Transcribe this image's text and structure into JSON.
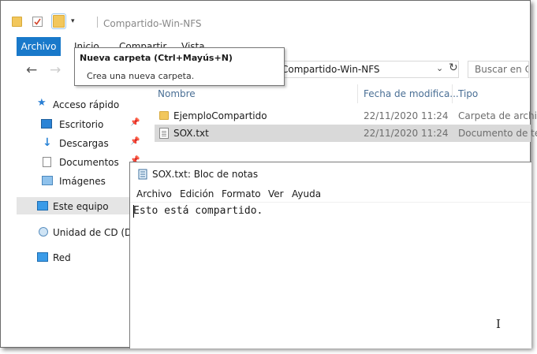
{
  "window": {
    "title": "Compartido-Win-NFS"
  },
  "ribbon": {
    "tabs": [
      {
        "label": "Archivo"
      },
      {
        "label": "Inicio"
      },
      {
        "label": "Compartir"
      },
      {
        "label": "Vista"
      }
    ]
  },
  "tooltip": {
    "title": "Nueva carpeta (Ctrl+Mayús+N)",
    "description": "Crea una nueva carpeta."
  },
  "address": {
    "path": "Compartido-Win-NFS"
  },
  "search": {
    "placeholder": "Buscar en Co"
  },
  "sidebar": {
    "items": [
      {
        "label": "Acceso rápido",
        "icon": "star-icon"
      },
      {
        "label": "Escritorio",
        "icon": "desktop-icon"
      },
      {
        "label": "Descargas",
        "icon": "download-icon"
      },
      {
        "label": "Documentos",
        "icon": "documents-icon"
      },
      {
        "label": "Imágenes",
        "icon": "images-icon"
      },
      {
        "label": "Este equipo",
        "icon": "computer-icon"
      },
      {
        "label": "Unidad de CD (D:)",
        "icon": "cd-drive-icon"
      },
      {
        "label": "Red",
        "icon": "network-icon"
      }
    ]
  },
  "columns": {
    "name": "Nombre",
    "date": "Fecha de modifica...",
    "type": "Tipo"
  },
  "files": [
    {
      "name": "EjemploCompartido",
      "date": "22/11/2020 11:24",
      "type": "Carpeta de archivos"
    },
    {
      "name": "SOX.txt",
      "date": "22/11/2020 11:24",
      "type": "Documento de texto"
    }
  ],
  "notepad": {
    "title": "SOX.txt: Bloc de notas",
    "menu": [
      "Archivo",
      "Edición",
      "Formato",
      "Ver",
      "Ayuda"
    ],
    "content": "Esto está compartido."
  },
  "colors": {
    "accent": "#1979ca",
    "selection": "#d9d9d9",
    "folder": "#f2c75c"
  }
}
